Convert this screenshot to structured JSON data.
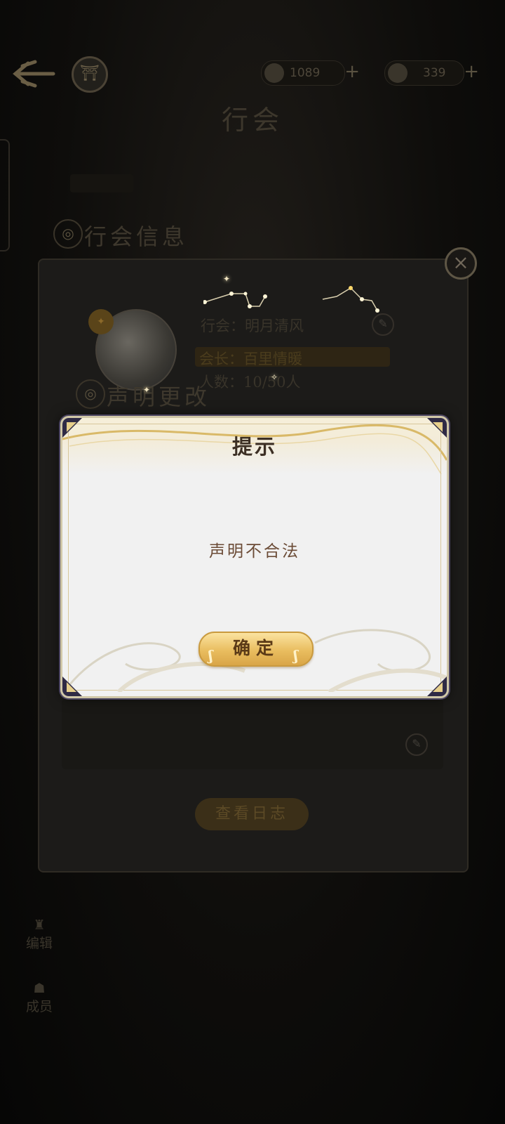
{
  "topbar": {
    "back_icon": "back-arrow-icon",
    "emblem_icon": "guild-emblem-icon",
    "resources": [
      {
        "icon": "coin-icon",
        "value": "1089"
      },
      {
        "icon": "gem-icon",
        "value": "339"
      }
    ],
    "plus": "+"
  },
  "page": {
    "title": "行会"
  },
  "sections": {
    "guild_info": "行会信息",
    "declaration_change": "声明更改"
  },
  "guild": {
    "name_line": "行会：明月清风",
    "leader_line": "会长：百里情暖",
    "members_line": "人数：10/50人"
  },
  "panel": {
    "close": "×",
    "log_button": "查看日志"
  },
  "side": {
    "item1": "编辑",
    "item2": "成员"
  },
  "dialog": {
    "title": "提示",
    "message": "声明不合法",
    "confirm": "确定"
  }
}
